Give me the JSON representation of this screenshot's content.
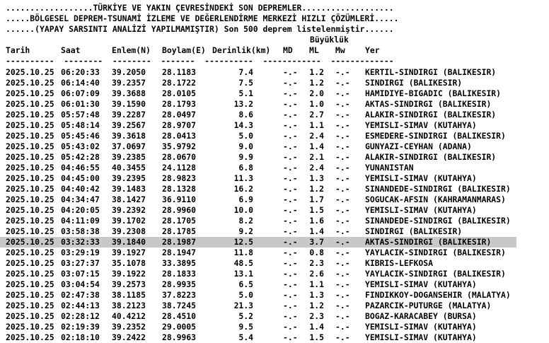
{
  "header": {
    "line1": "..................TÜRKİYE VE YAKIN ÇEVRESİNDEKİ SON DEPREMLER...................",
    "line2": ".....BÖLGESEL DEPREM-TSUNAMİ İZLEME VE DEĞERLENDİRME MERKEZİ HIZLI ÇÖZÜMLERİ.....",
    "line3": "......(YAPAY SARSINTI ANALİZİ YAPILMAMIŞTIR) Son 500 deprem listelenmiştir......"
  },
  "columns": {
    "magnitude_group": "Büyüklük",
    "date": "Tarih",
    "time": "Saat",
    "lat": "Enlem(N)",
    "lon": "Boylam(E)",
    "depth": "Derinlik(km)",
    "md": "MD",
    "ml": "ML",
    "mw": "Mw",
    "place": "Yer"
  },
  "dash_line": "----------  --------  --------  -------  ----------  ------------  -------------",
  "rows": [
    {
      "date": "2025.10.25",
      "time": "06:20:33",
      "lat": "39.2050",
      "lon": "28.1183",
      "depth": "7.4",
      "md": "-.-",
      "ml": "1.2",
      "mw": "-.-",
      "place": "KERTIL-SINDIRGI (BALIKESIR)"
    },
    {
      "date": "2025.10.25",
      "time": "06:14:40",
      "lat": "39.2357",
      "lon": "28.1722",
      "depth": "7.5",
      "md": "-.-",
      "ml": "1.2",
      "mw": "-.-",
      "place": "SINDIRGI (BALIKESIR)"
    },
    {
      "date": "2025.10.25",
      "time": "06:07:09",
      "lat": "39.3688",
      "lon": "28.0105",
      "depth": "5.1",
      "md": "-.-",
      "ml": "2.0",
      "mw": "-.-",
      "place": "HAMIDIYE-BIGADIC (BALIKESIR)"
    },
    {
      "date": "2025.10.25",
      "time": "06:01:30",
      "lat": "39.1590",
      "lon": "28.1793",
      "depth": "13.2",
      "md": "-.-",
      "ml": "1.0",
      "mw": "-.-",
      "place": "AKTAS-SINDIRGI (BALIKESIR)"
    },
    {
      "date": "2025.10.25",
      "time": "05:57:48",
      "lat": "39.2287",
      "lon": "28.0497",
      "depth": "8.6",
      "md": "-.-",
      "ml": "2.7",
      "mw": "-.-",
      "place": "ALAKIR-SINDIRGI (BALIKESIR)"
    },
    {
      "date": "2025.10.25",
      "time": "05:48:14",
      "lat": "39.2567",
      "lon": "28.9707",
      "depth": "14.3",
      "md": "-.-",
      "ml": "1.1",
      "mw": "-.-",
      "place": "YEMISLI-SIMAV (KUTAHYA)"
    },
    {
      "date": "2025.10.25",
      "time": "05:45:46",
      "lat": "39.3618",
      "lon": "28.0413",
      "depth": "5.0",
      "md": "-.-",
      "ml": "2.4",
      "mw": "-.-",
      "place": "ESMEDERE-SINDIRGI (BALIKESIR)"
    },
    {
      "date": "2025.10.25",
      "time": "05:43:02",
      "lat": "37.0697",
      "lon": "35.9792",
      "depth": "9.0",
      "md": "-.-",
      "ml": "1.4",
      "mw": "-.-",
      "place": "GUNYAZI-CEYHAN (ADANA)"
    },
    {
      "date": "2025.10.25",
      "time": "05:42:28",
      "lat": "39.2385",
      "lon": "28.0670",
      "depth": "9.9",
      "md": "-.-",
      "ml": "2.1",
      "mw": "-.-",
      "place": "ALAKIR-SINDIRGI (BALIKESIR)"
    },
    {
      "date": "2025.10.25",
      "time": "04:46:55",
      "lat": "40.3455",
      "lon": "24.1128",
      "depth": "6.8",
      "md": "-.-",
      "ml": "2.4",
      "mw": "-.-",
      "place": "YUNANISTAN"
    },
    {
      "date": "2025.10.25",
      "time": "04:45:00",
      "lat": "39.2395",
      "lon": "28.9823",
      "depth": "11.3",
      "md": "-.-",
      "ml": "1.3",
      "mw": "-.-",
      "place": "YEMISLI-SIMAV (KUTAHYA)"
    },
    {
      "date": "2025.10.25",
      "time": "04:40:42",
      "lat": "39.1483",
      "lon": "28.1328",
      "depth": "16.2",
      "md": "-.-",
      "ml": "1.2",
      "mw": "-.-",
      "place": "SINANDEDE-SINDIRGI (BALIKESIR)"
    },
    {
      "date": "2025.10.25",
      "time": "04:34:47",
      "lat": "38.1427",
      "lon": "36.9110",
      "depth": "6.9",
      "md": "-.-",
      "ml": "1.7",
      "mw": "-.-",
      "place": "SOGUCAK-AFSIN (KAHRAMANMARAS)"
    },
    {
      "date": "2025.10.25",
      "time": "04:20:05",
      "lat": "39.2392",
      "lon": "28.9960",
      "depth": "10.0",
      "md": "-.-",
      "ml": "1.5",
      "mw": "-.-",
      "place": "YEMISLI-SIMAV (KUTAHYA)"
    },
    {
      "date": "2025.10.25",
      "time": "04:11:09",
      "lat": "39.1702",
      "lon": "28.1705",
      "depth": "8.2",
      "md": "-.-",
      "ml": "1.6",
      "mw": "-.-",
      "place": "SINANDEDE-SINDIRGI (BALIKESIR)"
    },
    {
      "date": "2025.10.25",
      "time": "03:58:38",
      "lat": "39.2308",
      "lon": "28.1785",
      "depth": "9.2",
      "md": "-.-",
      "ml": "1.4",
      "mw": "-.-",
      "place": "SINDIRGI (BALIKESIR)"
    },
    {
      "date": "2025.10.25",
      "time": "03:32:33",
      "lat": "39.1840",
      "lon": "28.1987",
      "depth": "12.5",
      "md": "-.-",
      "ml": "3.7",
      "mw": "-.-",
      "place": "AKTAS-SINDIRGI (BALIKESIR)",
      "selected": true
    },
    {
      "date": "2025.10.25",
      "time": "03:29:19",
      "lat": "39.1927",
      "lon": "28.1947",
      "depth": "11.8",
      "md": "-.-",
      "ml": "0.8",
      "mw": "-.-",
      "place": "YAYLACIK-SINDIRGI (BALIKESIR)"
    },
    {
      "date": "2025.10.25",
      "time": "03:27:37",
      "lat": "35.1078",
      "lon": "33.3895",
      "depth": "48.5",
      "md": "-.-",
      "ml": "2.3",
      "mw": "-.-",
      "place": "KIBRIS-LEFKOSA"
    },
    {
      "date": "2025.10.25",
      "time": "03:07:15",
      "lat": "39.1922",
      "lon": "28.1833",
      "depth": "13.1",
      "md": "-.-",
      "ml": "2.6",
      "mw": "-.-",
      "place": "YAYLACIK-SINDIRGI (BALIKESIR)"
    },
    {
      "date": "2025.10.25",
      "time": "03:04:54",
      "lat": "39.2573",
      "lon": "28.9935",
      "depth": "6.5",
      "md": "-.-",
      "ml": "1.1",
      "mw": "-.-",
      "place": "YEMISLI-SIMAV (KUTAHYA)"
    },
    {
      "date": "2025.10.25",
      "time": "02:47:38",
      "lat": "38.1185",
      "lon": "37.8223",
      "depth": "5.0",
      "md": "-.-",
      "ml": "1.3",
      "mw": "-.-",
      "place": "FINDIKKOY-DOGANSEHIR (MALATYA)"
    },
    {
      "date": "2025.10.25",
      "time": "02:44:13",
      "lat": "38.2123",
      "lon": "38.7245",
      "depth": "21.3",
      "md": "-.-",
      "ml": "1.2",
      "mw": "-.-",
      "place": "PAZARCIK-PUTURGE (MALATYA)"
    },
    {
      "date": "2025.10.25",
      "time": "02:28:12",
      "lat": "40.4212",
      "lon": "28.4510",
      "depth": "5.2",
      "md": "-.-",
      "ml": "2.3",
      "mw": "-.-",
      "place": "BOGAZ-KARACABEY (BURSA)"
    },
    {
      "date": "2025.10.25",
      "time": "02:19:39",
      "lat": "39.2352",
      "lon": "29.0005",
      "depth": "9.5",
      "md": "-.-",
      "ml": "1.4",
      "mw": "-.-",
      "place": "YEMISLI-SIMAV (KUTAHYA)"
    },
    {
      "date": "2025.10.25",
      "time": "02:18:10",
      "lat": "39.2422",
      "lon": "28.9963",
      "depth": "5.4",
      "md": "-.-",
      "ml": "1.5",
      "mw": "-.-",
      "place": "YEMISLI-SIMAV (KUTAHYA)"
    }
  ]
}
